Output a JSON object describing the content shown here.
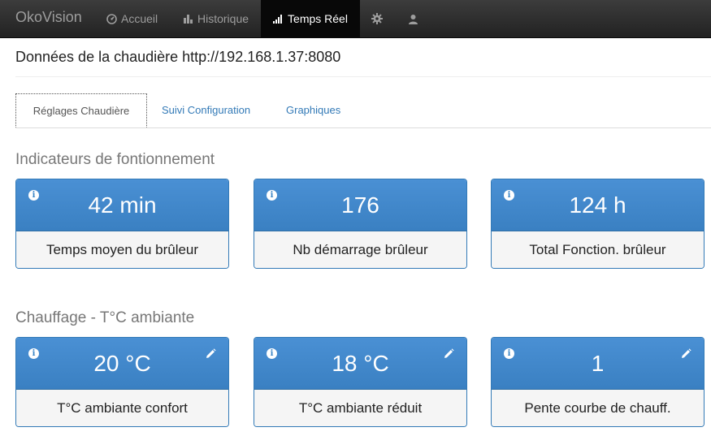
{
  "navbar": {
    "brand": "OkoVision",
    "items": [
      {
        "label": "Accueil",
        "icon": "dashboard-icon"
      },
      {
        "label": "Historique",
        "icon": "bar-chart-icon"
      },
      {
        "label": "Temps Réel",
        "icon": "signal-icon",
        "active": true
      },
      {
        "label": "",
        "icon": "gear-icon"
      },
      {
        "label": "",
        "icon": "user-icon"
      }
    ]
  },
  "page": {
    "title": "Données de la chaudière http://192.168.1.37:8080"
  },
  "tabs": [
    {
      "label": "Réglages Chaudière",
      "active": true
    },
    {
      "label": "Suivi Configuration"
    },
    {
      "label": "Graphiques"
    }
  ],
  "sections": [
    {
      "title": "Indicateurs de fontionnement",
      "cards": [
        {
          "value": "42 min",
          "label": "Temps moyen du brûleur"
        },
        {
          "value": "176",
          "label": "Nb démarrage brûleur"
        },
        {
          "value": "124 h",
          "label": "Total Fonction. brûleur"
        }
      ]
    },
    {
      "title": "Chauffage - T°C ambiante",
      "cards": [
        {
          "value": "20 °C",
          "label": "T°C ambiante confort",
          "editable": true
        },
        {
          "value": "18 °C",
          "label": "T°C ambiante réduit",
          "editable": true
        },
        {
          "value": "1",
          "label": "Pente courbe de chauff.",
          "editable": true
        }
      ]
    }
  ],
  "colors": {
    "navbar": "#222222",
    "card_header": "#3a85c6",
    "card_footer": "#f5f5f5",
    "link": "#337ab7"
  }
}
